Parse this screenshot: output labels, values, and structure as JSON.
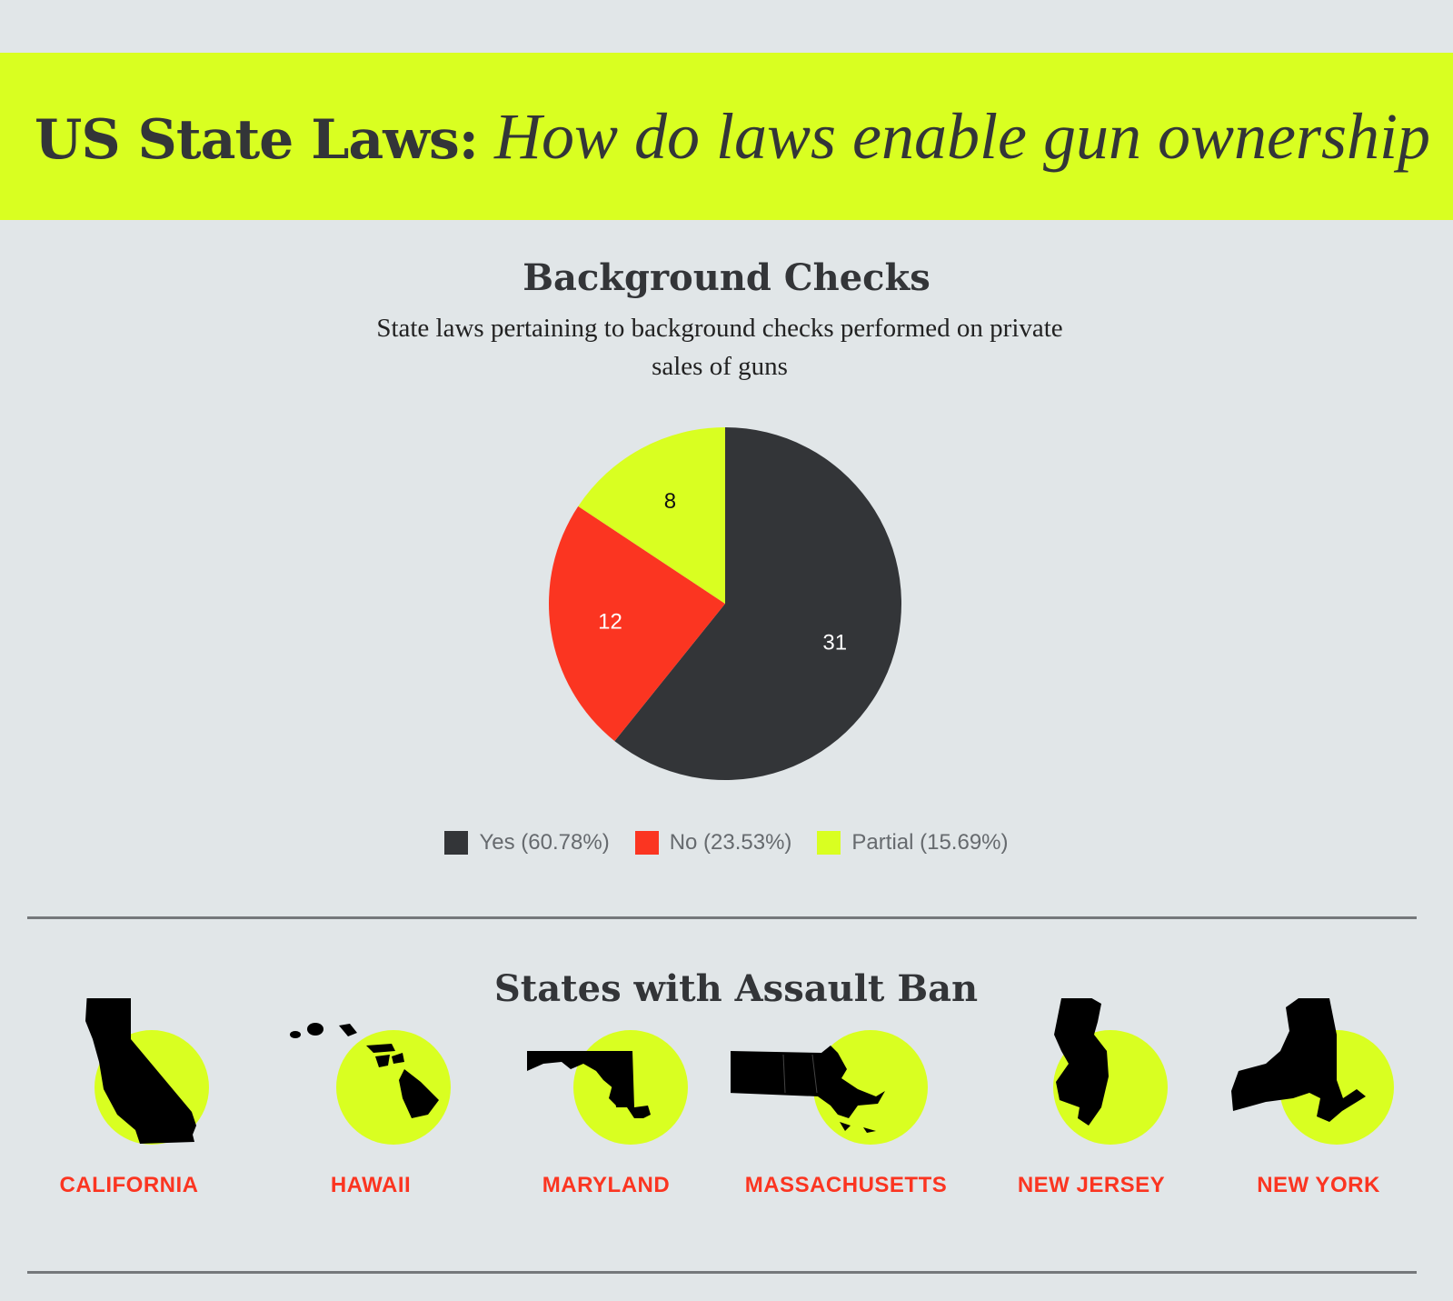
{
  "header": {
    "title_bold": "US State Laws:",
    "title_italic": "How do laws enable gun ownership"
  },
  "chart_data": {
    "type": "pie",
    "title": "Background Checks",
    "subtitle": "State laws pertaining to background checks performed on private sales of guns",
    "series": [
      {
        "name": "Yes",
        "value": 31,
        "label": "31",
        "legend": "Yes (60.78%)",
        "color": "#333538"
      },
      {
        "name": "No",
        "value": 12,
        "label": "12",
        "legend": "No (23.53%)",
        "color": "#fb3521"
      },
      {
        "name": "Partial",
        "value": 8,
        "label": "8",
        "legend": "Partial (15.69%)",
        "color": "#d9ff21"
      }
    ],
    "legend_position": "bottom"
  },
  "assault_ban": {
    "title": "States with Assault Ban",
    "states": [
      {
        "label": "CALIFORNIA",
        "icon": "california-map-icon"
      },
      {
        "label": "HAWAII",
        "icon": "hawaii-map-icon"
      },
      {
        "label": "MARYLAND",
        "icon": "maryland-map-icon"
      },
      {
        "label": "MASSACHUSETTS",
        "icon": "massachusetts-map-icon"
      },
      {
        "label": "NEW JERSEY",
        "icon": "new-jersey-map-icon"
      },
      {
        "label": "NEW YORK",
        "icon": "new-york-map-icon"
      }
    ],
    "circle_color": "#d9ff21",
    "label_color": "#fb3521"
  }
}
